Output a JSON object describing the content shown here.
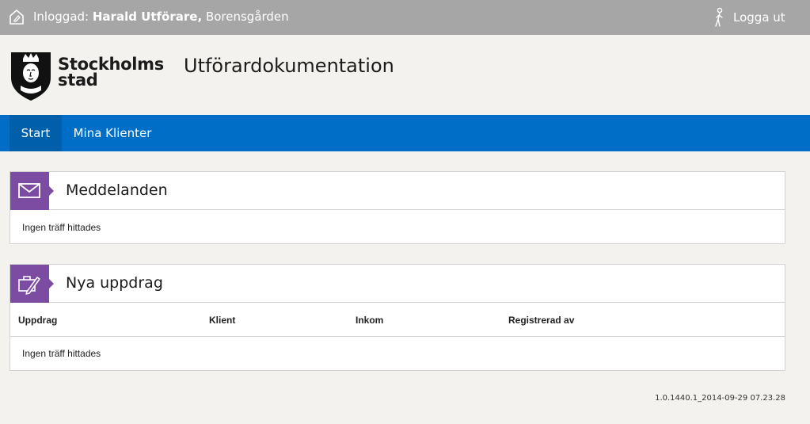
{
  "topbar": {
    "logged_in_label": "Inloggad:",
    "user_name": "Harald Utförare,",
    "unit": "Borensgården",
    "logout_label": "Logga ut",
    "home_icon": "home-pen-icon",
    "logout_icon": "person-icon"
  },
  "header": {
    "brand_line1": "Stockholms",
    "brand_line2": "stad",
    "app_title": "Utförardokumentation",
    "logo_icon": "stockholm-crest-icon"
  },
  "nav": {
    "tabs": [
      {
        "label": "Start",
        "active": true
      },
      {
        "label": "Mina Klienter",
        "active": false
      }
    ]
  },
  "messages": {
    "title": "Meddelanden",
    "icon": "envelope-icon",
    "empty_text": "Ingen träff hittades"
  },
  "assignments": {
    "title": "Nya uppdrag",
    "icon": "briefcase-pen-icon",
    "columns": [
      "Uppdrag",
      "Klient",
      "Inkom",
      "Registrerad av"
    ],
    "empty_text": "Ingen träff hittades"
  },
  "footer": {
    "version": "1.0.1440.1_2014-09-29 07.23.28"
  },
  "colors": {
    "topbar_bg": "#a6a6a6",
    "nav_bg": "#006ec6",
    "nav_active_bg": "#005fab",
    "panel_icon_bg": "#7c4ba2",
    "page_bg": "#f3f2ee"
  }
}
